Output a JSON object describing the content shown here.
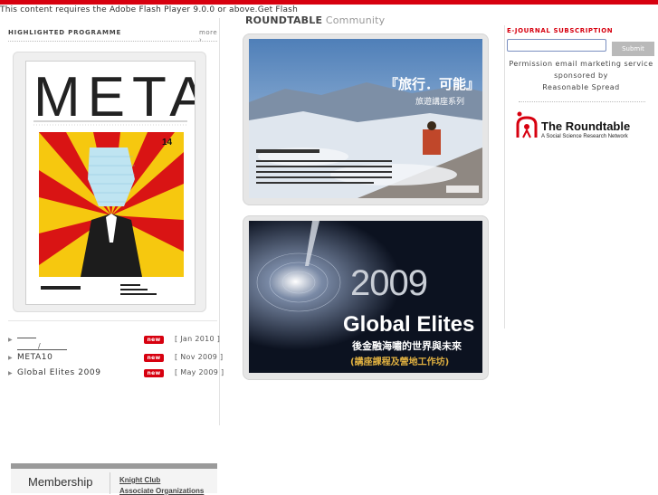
{
  "flash_notice": {
    "text": "This content requires the Adobe Flash Player 9.0.0 or above.",
    "link": "Get Flash"
  },
  "highlighted": {
    "title": "HIGHLIGHTED PROGRAMME",
    "more": "more",
    "cover_title": "META",
    "cover_issue": "14",
    "programmes": [
      {
        "name": "",
        "badge": "new",
        "date": "[ Jan 2010 ]"
      },
      {
        "name": "META10",
        "badge": "new",
        "date": "[ Nov 2009 ]"
      },
      {
        "name": "Global Elites 2009",
        "badge": "new",
        "date": "[ May 2009 ]"
      }
    ]
  },
  "roundtable": {
    "brand": "ROUNDTABLE",
    "community": "Community",
    "card1": {
      "heading": "『旅行．可能』",
      "subheading": "旅遊講座系列"
    },
    "card2": {
      "year": "2009",
      "title": "Global Elites",
      "line1": "後金融海嘯的世界與未來",
      "line2": "(講座課程及營地工作坊)"
    }
  },
  "ejournal": {
    "title": "E-JOURNAL SUBSCRIPTION",
    "input_value": "",
    "submit_label": "Submit",
    "line1": "Permission email marketing service",
    "line2": "sponsored by",
    "line3": "Reasonable Spread",
    "logo_title": "The Roundtable",
    "logo_subtitle": "A Social Science Research Network"
  },
  "membership": {
    "title": "Membership",
    "items": [
      "Knight Club",
      "Associate Organizations"
    ]
  },
  "colors": {
    "accent_red": "#d7000f",
    "badge_red": "#d7000f"
  }
}
